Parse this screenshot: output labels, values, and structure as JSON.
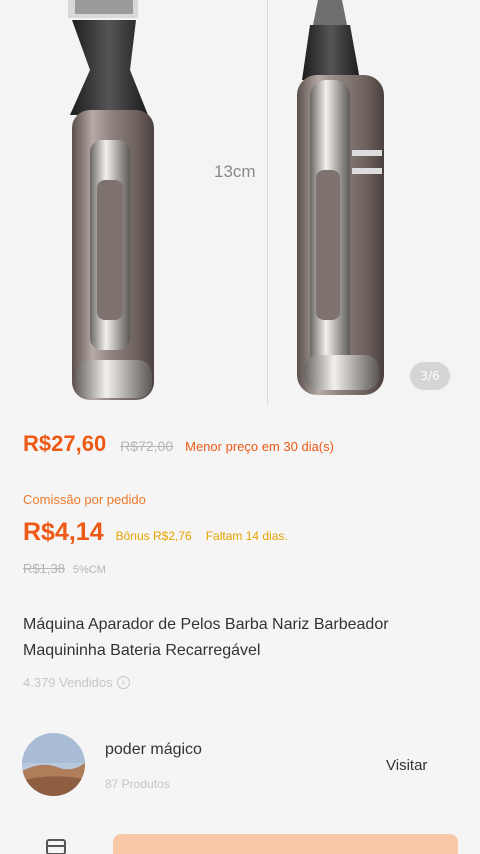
{
  "gallery": {
    "dimension_label": "13cm",
    "counter": "3/6"
  },
  "pricing": {
    "price": "R$27,60",
    "original_price": "R$72,00",
    "best_price_note": "Menor preço em 30 dia(s)"
  },
  "commission": {
    "label": "Comissão por pedido",
    "value": "R$4,14",
    "bonus": "Bônus R$2,76",
    "remaining": "Faltam 14 dias.",
    "original_value": "R$1,38",
    "rate": "5%CM"
  },
  "product": {
    "title": "Máquina Aparador de Pelos Barba Nariz Barbeador Maquininha Bateria Recarregável",
    "sold": "4.379 Vendidos",
    "sold_info_icon": "info-icon"
  },
  "shop": {
    "name": "poder mágico",
    "products": "87 Produtos",
    "visit_label": "Visitar"
  },
  "colors": {
    "accent": "#ee5a16",
    "bonus": "#e7a300",
    "muted": "#b5b5b5"
  }
}
